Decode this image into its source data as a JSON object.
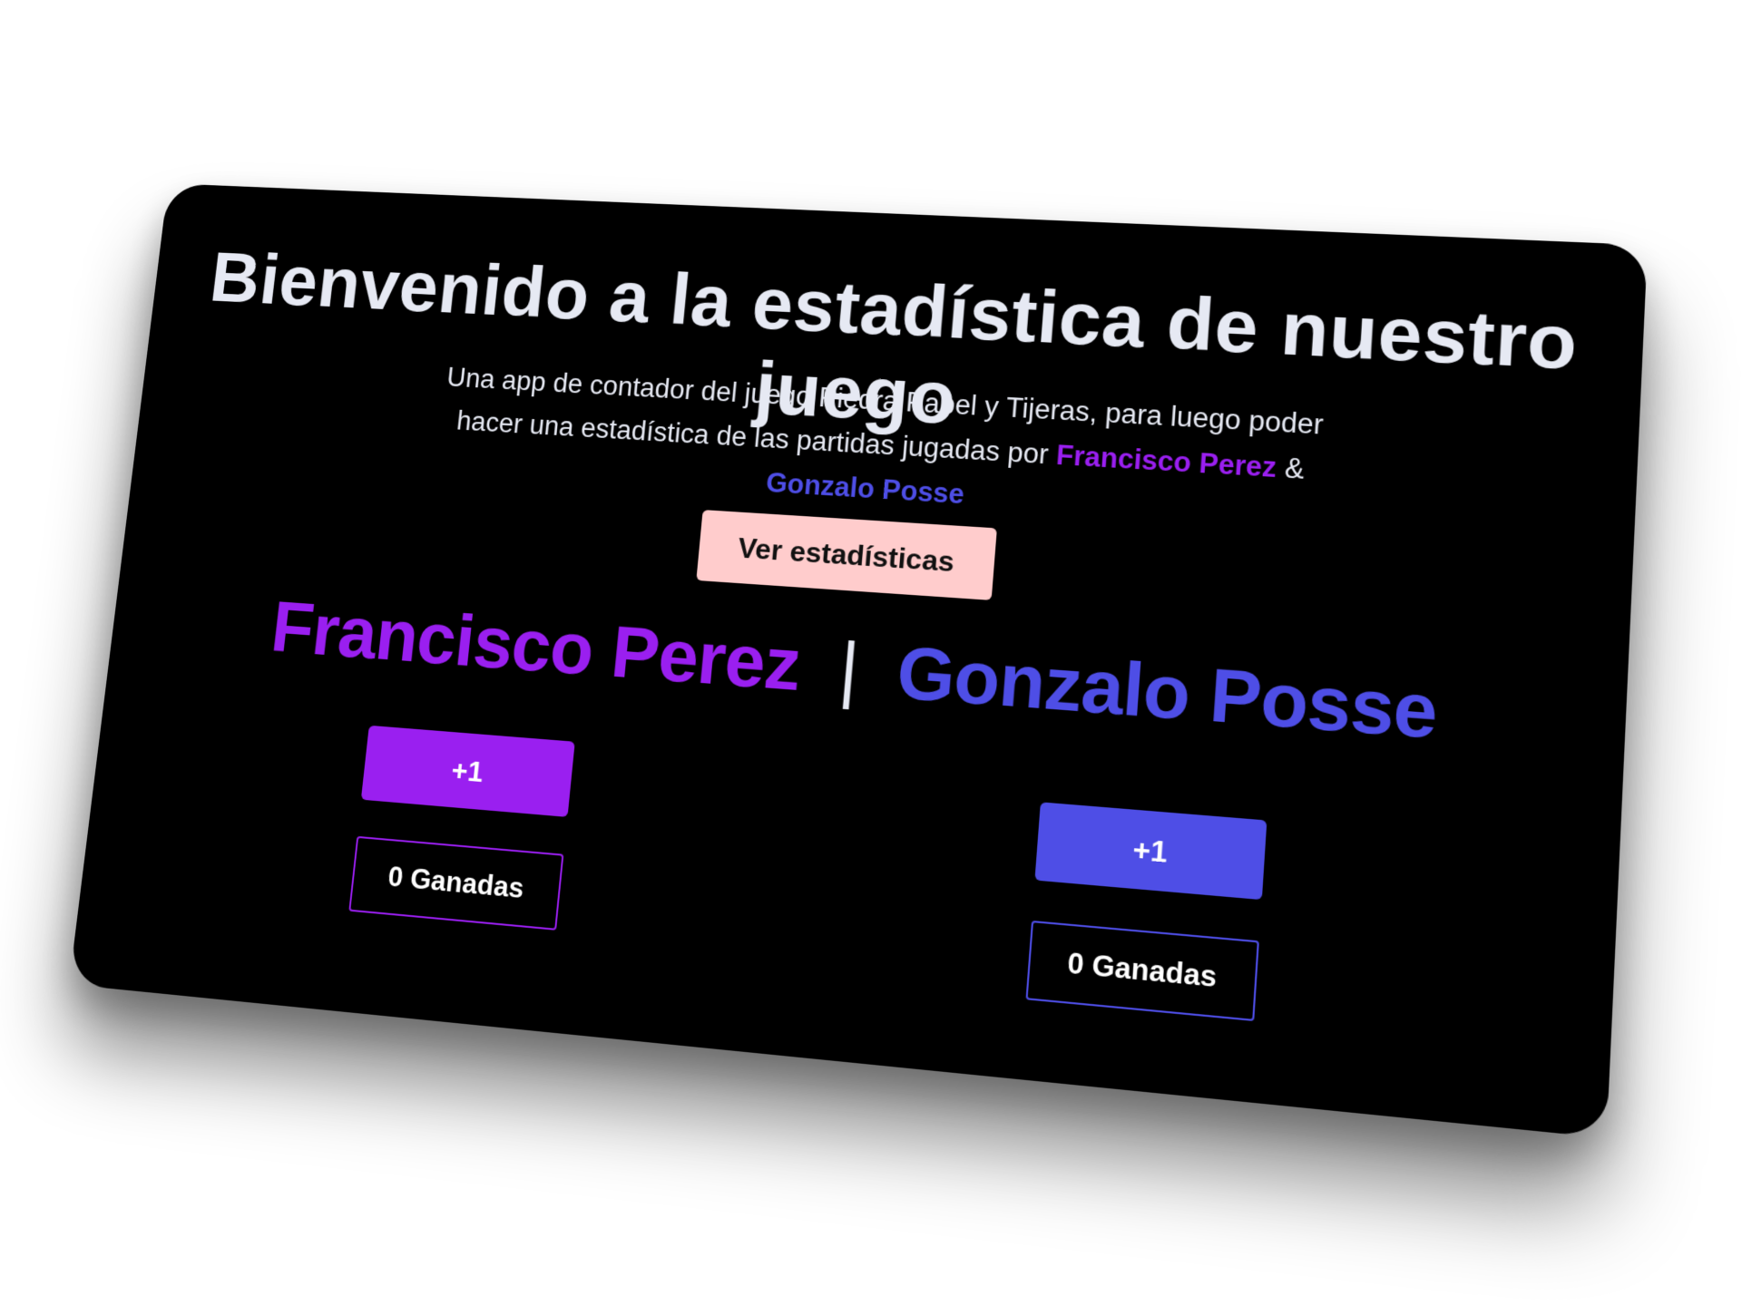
{
  "header": {
    "title": "Bienvenido a la estadística de nuestro juego"
  },
  "description": {
    "text": "Una app de contador del juego Piedra Papel y Tijeras, para luego poder hacer una estadística de las partidas jugadas por",
    "player_one": "Francisco Perez",
    "connector": "&",
    "player_two": "Gonzalo Posse"
  },
  "actions": {
    "stats_label": "Ver estadísticas"
  },
  "players": {
    "divider": "|",
    "one": {
      "name": "Francisco Perez",
      "increment_label": "+1",
      "wins_label": "0 Ganadas",
      "color": "#9a1ff0"
    },
    "two": {
      "name": "Gonzalo Posse",
      "increment_label": "+1",
      "wins_label": "0 Ganadas",
      "color": "#4e4ee6"
    }
  },
  "colors": {
    "background": "#000000",
    "text": "#e6e9f3",
    "stats_button": "#ffcccc"
  }
}
